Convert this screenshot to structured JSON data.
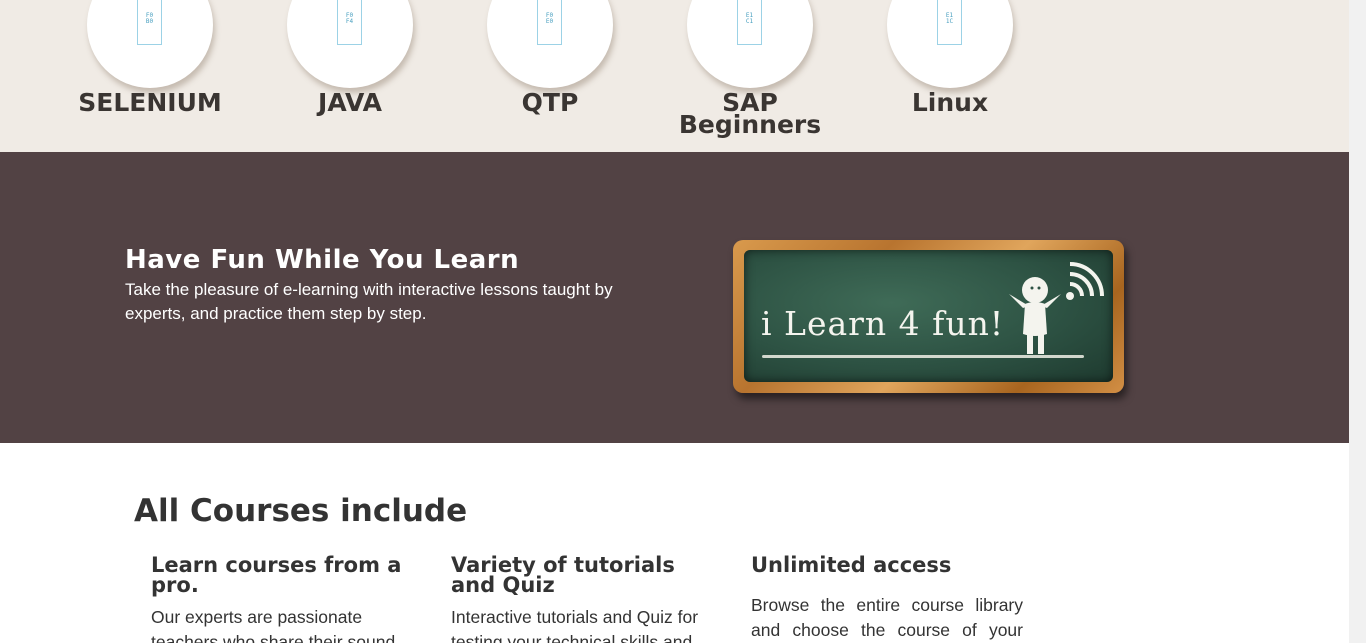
{
  "courses": [
    {
      "label": "SELENIUM",
      "icon_text": "F0\nB0",
      "icon": "course-placeholder-icon"
    },
    {
      "label": "JAVA",
      "icon_text": "F0\nF4",
      "icon": "course-placeholder-icon"
    },
    {
      "label": "QTP",
      "icon_text": "F0\nE0",
      "icon": "course-placeholder-icon"
    },
    {
      "label": "SAP\nBeginners",
      "icon_text": "E1\nC1",
      "icon": "course-placeholder-icon"
    },
    {
      "label": "Linux",
      "icon_text": "E1\n1C",
      "icon": "course-placeholder-icon"
    }
  ],
  "fun": {
    "title": "Have Fun While You Learn",
    "text": "Take the pleasure of e-learning with interactive lessons taught by experts, and practice them step by step.",
    "board_text": "i Learn 4 fun!"
  },
  "include": {
    "title": "All Courses include",
    "features": [
      {
        "title": "Learn courses from a pro.",
        "text": "Our experts are passionate teachers who share their sound"
      },
      {
        "title": "Variety of tutorials and Quiz",
        "text": "Interactive tutorials and Quiz for testing your technical skills and"
      },
      {
        "title": "Unlimited access",
        "text": "Browse the entire course library and choose the course of your interest"
      }
    ]
  },
  "colors": {
    "strip_bg": "#f0ebe5",
    "banner_bg": "#524244",
    "text_dark": "#333333"
  }
}
